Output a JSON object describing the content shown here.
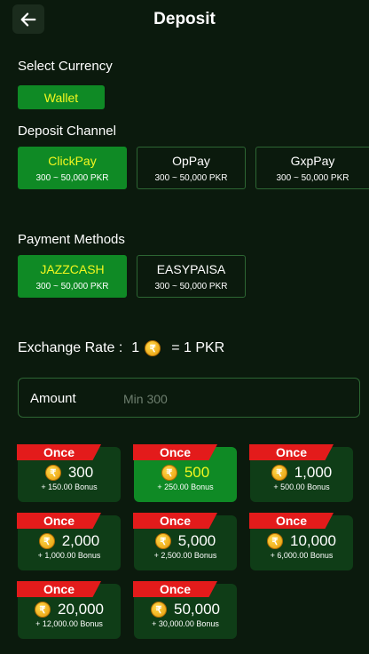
{
  "header": {
    "title": "Deposit",
    "back_icon": "arrow-left-icon"
  },
  "currency": {
    "label": "Select Currency",
    "wallet": "Wallet"
  },
  "channel": {
    "label": "Deposit Channel",
    "options": [
      {
        "name": "ClickPay",
        "range": "300 ~ 50,000 PKR",
        "selected": true
      },
      {
        "name": "OpPay",
        "range": "300 ~ 50,000 PKR",
        "selected": false
      },
      {
        "name": "GxpPay",
        "range": "300 ~ 50,000 PKR",
        "selected": false
      }
    ]
  },
  "payment": {
    "label": "Payment Methods",
    "options": [
      {
        "name": "JAZZCASH",
        "range": "300 ~ 50,000 PKR",
        "selected": true
      },
      {
        "name": "EASYPAISA",
        "range": "300 ~ 50,000 PKR",
        "selected": false
      }
    ]
  },
  "rate": {
    "prefix": "Exchange Rate :",
    "amount": "1",
    "coin_glyph": "₹",
    "suffix": "= 1 PKR"
  },
  "amount_field": {
    "label": "Amount",
    "placeholder": "Min 300",
    "value": ""
  },
  "packages": [
    {
      "tag": "Once",
      "amount": "300",
      "bonus": "+ 150.00 Bonus",
      "selected": false
    },
    {
      "tag": "Once",
      "amount": "500",
      "bonus": "+ 250.00 Bonus",
      "selected": true
    },
    {
      "tag": "Once",
      "amount": "1,000",
      "bonus": "+ 500.00 Bonus",
      "selected": false
    },
    {
      "tag": "Once",
      "amount": "2,000",
      "bonus": "+ 1,000.00 Bonus",
      "selected": false
    },
    {
      "tag": "Once",
      "amount": "5,000",
      "bonus": "+ 2,500.00 Bonus",
      "selected": false
    },
    {
      "tag": "Once",
      "amount": "10,000",
      "bonus": "+ 6,000.00 Bonus",
      "selected": false
    },
    {
      "tag": "Once",
      "amount": "20,000",
      "bonus": "+ 12,000.00 Bonus",
      "selected": false
    },
    {
      "tag": "Once",
      "amount": "50,000",
      "bonus": "+ 30,000.00 Bonus",
      "selected": false
    }
  ],
  "colors": {
    "background": "#0b1a0d",
    "accent_green": "#0f8a25",
    "highlight_yellow": "#f3f71f",
    "tag_red": "#e31b1b",
    "border_green": "#2d6633"
  }
}
